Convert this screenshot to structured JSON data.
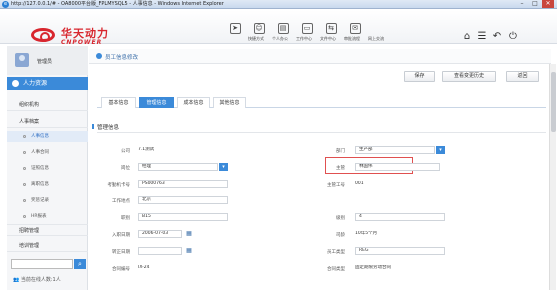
{
  "window": {
    "title": "http://127.0.0.1/# - OA8000平台版_FPLMYSQL5 - 人事信息 - Windows Internet Explorer"
  },
  "brand": {
    "name_cn": "华天动力",
    "name_en": "CNPOWER"
  },
  "topnav": [
    {
      "label": "快捷方式",
      "icon": "send-icon",
      "glyph": "➤"
    },
    {
      "label": "个人办公",
      "icon": "person-icon",
      "glyph": "☺"
    },
    {
      "label": "工作中心",
      "icon": "desk-icon",
      "glyph": "▤"
    },
    {
      "label": "文件中心",
      "icon": "folder-icon",
      "glyph": "▭"
    },
    {
      "label": "审批流程",
      "icon": "flow-icon",
      "glyph": "⇆"
    },
    {
      "label": "网上交流",
      "icon": "chat-icon",
      "glyph": "✉"
    }
  ],
  "header_icons": [
    {
      "name": "home-icon",
      "glyph": "⌂"
    },
    {
      "name": "menu-icon",
      "glyph": "☰"
    },
    {
      "name": "back-icon",
      "glyph": "↶"
    },
    {
      "name": "power-icon",
      "glyph": "⏻"
    }
  ],
  "sidebar": {
    "user_name": "管理员",
    "module": "人力资源",
    "items": [
      {
        "label": "组织机构"
      },
      {
        "label": "人事档案"
      }
    ],
    "subitems": [
      {
        "label": "人事信息",
        "active": true
      },
      {
        "label": "人事合同",
        "active": false
      },
      {
        "label": "证照信息",
        "active": false
      },
      {
        "label": "离职信息",
        "active": false
      },
      {
        "label": "奖惩记录",
        "active": false
      },
      {
        "label": "HR报表",
        "active": false
      }
    ],
    "bottom_items": [
      {
        "label": "招聘管理"
      },
      {
        "label": "培训管理"
      }
    ],
    "search_placeholder": "",
    "online_text": "当前在线人数:1人"
  },
  "breadcrumb": "员工信息修改",
  "actions": {
    "save": "保存",
    "history": "查看变更历史",
    "back": "返回"
  },
  "tabs": [
    {
      "label": "基本信息",
      "active": false
    },
    {
      "label": "管理信息",
      "active": true
    },
    {
      "label": "成本信息",
      "active": false
    },
    {
      "label": "其他信息",
      "active": false
    }
  ],
  "section_title": "管理信息",
  "form": {
    "company": {
      "label": "公司",
      "value": "7.1测试"
    },
    "department": {
      "label": "部门",
      "value": "生产部"
    },
    "position": {
      "label": "岗位",
      "value": "经理"
    },
    "supervisor": {
      "label": "主管",
      "value": "林国伟"
    },
    "attendance_card": {
      "label": "考勤机卡号",
      "value": "PS000763"
    },
    "supervisor_no": {
      "label": "主管工号",
      "value": "001"
    },
    "work_location": {
      "label": "工作地点",
      "value": "北京"
    },
    "rank": {
      "label": "职别",
      "value": "B15"
    },
    "grade": {
      "label": "级别",
      "value": "4"
    },
    "hire_date": {
      "label": "入职日期",
      "value": "2006-07-03"
    },
    "seniority": {
      "label": "司龄",
      "value": "10年5个月"
    },
    "regular_date": {
      "label": "转正日期",
      "value": ""
    },
    "employee_type": {
      "label": "员工类型",
      "value": "REG"
    },
    "contract_no": {
      "label": "合同编号",
      "value": "IX-24"
    },
    "contract_type": {
      "label": "合同类型",
      "value": "固定期限劳动合同"
    }
  },
  "colors": {
    "accent": "#3b8ad9",
    "brand": "#d8262e",
    "highlight": "#e05050"
  }
}
